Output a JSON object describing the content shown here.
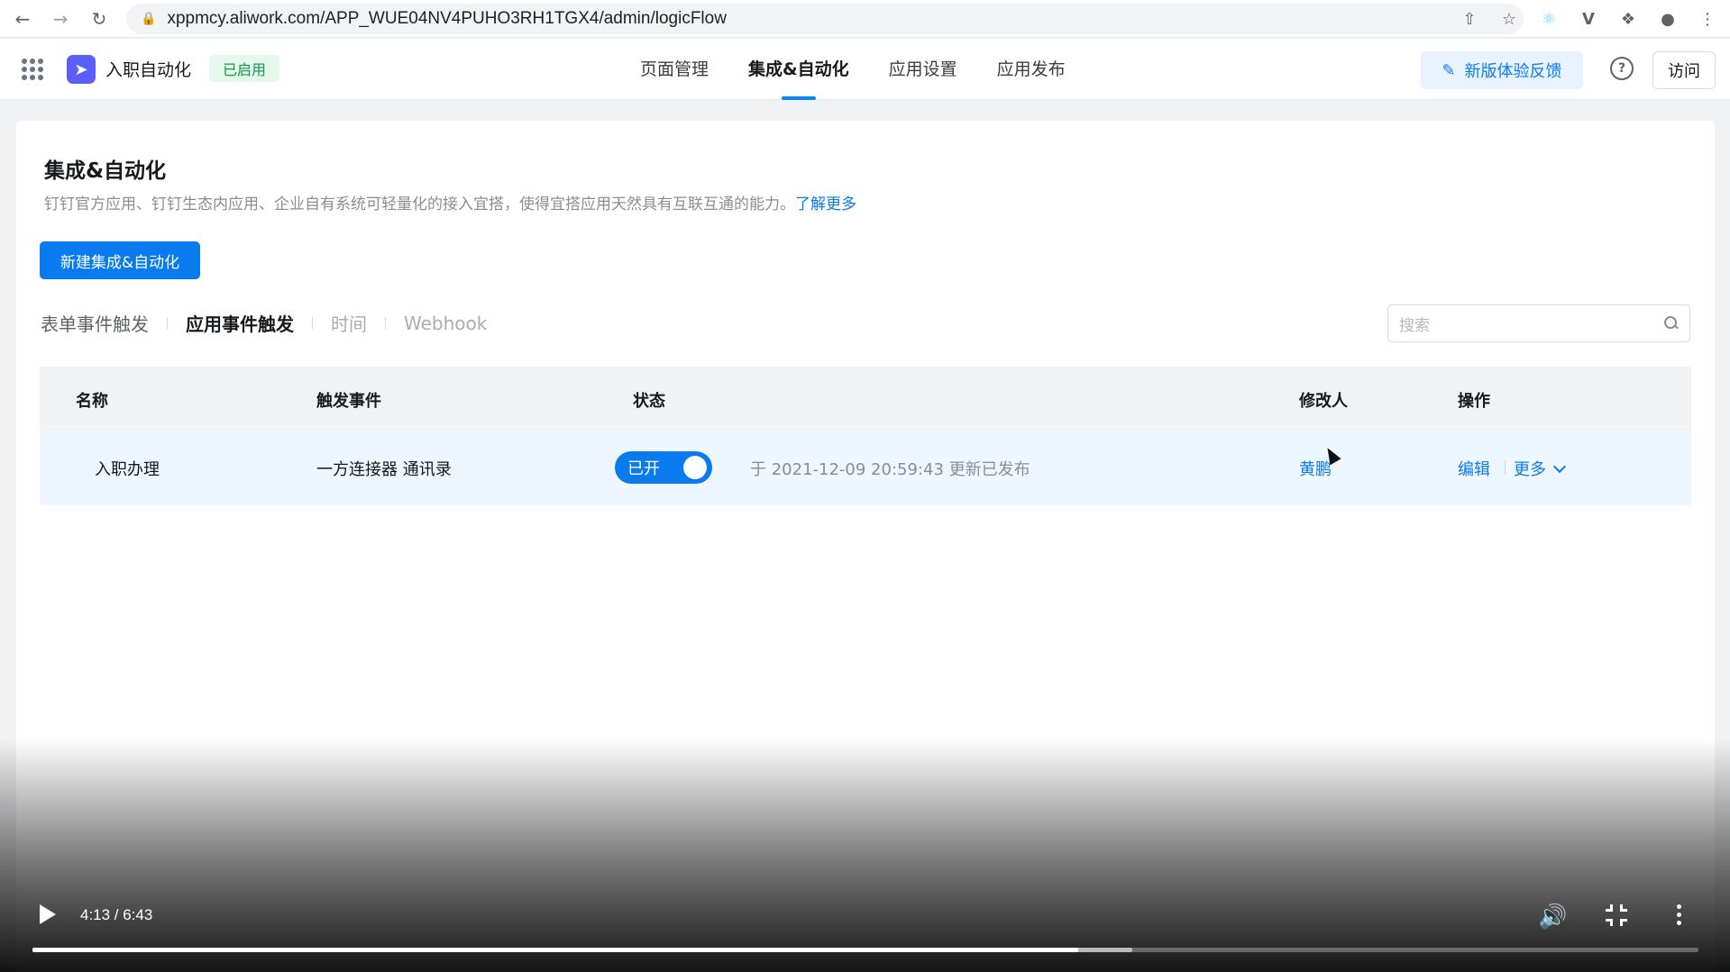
{
  "browser": {
    "url": "xppmcy.aliwork.com/APP_WUE04NV4PUHO3RH1TGX4/admin/logicFlow",
    "back_icon": "arrow-left-icon",
    "forward_icon": "arrow-right-icon",
    "reload_icon": "reload-icon"
  },
  "header": {
    "app_name": "入职自动化",
    "status": "已启用",
    "tabs": [
      {
        "label": "页面管理"
      },
      {
        "label": "集成&自动化"
      },
      {
        "label": "应用设置"
      },
      {
        "label": "应用发布"
      }
    ],
    "active_tab": 1,
    "feedback_label": "新版体验反馈",
    "visit_label": "访问"
  },
  "page": {
    "title": "集成&自动化",
    "description": "钉钉官方应用、钉钉生态内应用、企业自有系统可轻量化的接入宜搭，使得宜搭应用天然具有互联互通的能力。",
    "learn_more": "了解更多",
    "new_button": "新建集成&自动化",
    "sub_tabs": [
      {
        "label": "表单事件触发"
      },
      {
        "label": "应用事件触发"
      },
      {
        "label": "时间"
      },
      {
        "label": "Webhook"
      }
    ],
    "active_sub_tab": 1,
    "search_placeholder": "搜索"
  },
  "table": {
    "columns": [
      "名称",
      "触发事件",
      "状态",
      "修改人",
      "操作"
    ],
    "rows": [
      {
        "name": "入职办理",
        "trigger": "一方连接器 通讯录",
        "status_label": "已开",
        "status_on": true,
        "updated": "于 2021-12-09 20:59:43 更新已发布",
        "modifier": "黄鹏",
        "edit_label": "编辑",
        "more_label": "更多"
      }
    ]
  },
  "video": {
    "time": "4:13 / 6:43",
    "progress": 0.6278,
    "buffered": 0.66
  },
  "colors": {
    "accent": "#0a7bef",
    "status_green": "#0b9a47",
    "logo": "#5b5ef7"
  }
}
